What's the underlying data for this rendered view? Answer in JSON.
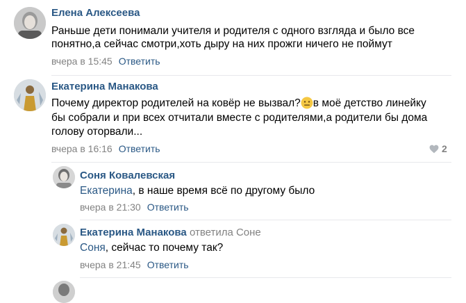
{
  "comments": [
    {
      "author": "Елена Алексеева",
      "lines": [
        "Раньше дети понимали учителя и родителя с одного взгляда и было все",
        "понятно,а сейчас смотри,хоть дыру на них прожги ничего не поймут"
      ],
      "time": "вчера в 15:45",
      "reply_label": "Ответить"
    },
    {
      "author": "Екатерина Манакова",
      "line1_before": "Почему директор родителей на ковёр не вызвал?",
      "line1_after": "в моё детство линейку",
      "line2": "бы собрали и при всех отчитали вместе с родителями,а родители бы дома",
      "line3": "голову оторвали...",
      "emoji_icon": "neutral-face-emoji",
      "time": "вчера в 16:16",
      "reply_label": "Ответить",
      "likes": "2",
      "like_icon": "heart-icon"
    },
    {
      "author": "Соня Ковалевская",
      "mention": "Екатерина",
      "text": ", в наше время всё по другому было",
      "time": "вчера в 21:30",
      "reply_label": "Ответить"
    },
    {
      "author": "Екатерина Манакова",
      "replied_to": "ответила Соне",
      "mention": "Соня",
      "text": ", сейчас то почему так?",
      "time": "вчера в 21:45",
      "reply_label": "Ответить"
    }
  ],
  "colors": {
    "link": "#2a5885",
    "meta": "#828282",
    "divider": "#e7e8ec"
  }
}
